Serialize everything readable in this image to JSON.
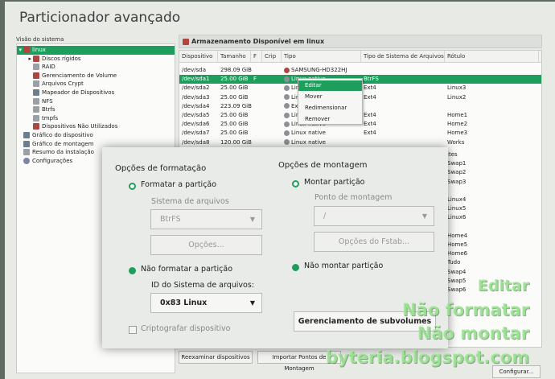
{
  "window": {
    "title": "Particionador avançado"
  },
  "sidebar": {
    "header": "Visão do sistema",
    "items": [
      {
        "label": "linux",
        "icon": "disk-icon",
        "indent": 0
      },
      {
        "label": "Discos rígidos",
        "icon": "disk-icon",
        "indent": 1
      },
      {
        "label": "RAID",
        "icon": "doc-icon",
        "indent": 1
      },
      {
        "label": "Gerenciamento de Volume",
        "icon": "disk-icon",
        "indent": 1
      },
      {
        "label": "Arquivos Crypt",
        "icon": "doc-icon",
        "indent": 1
      },
      {
        "label": "Mapeador de Dispositivos",
        "icon": "box-icon",
        "indent": 1
      },
      {
        "label": "NFS",
        "icon": "doc-icon",
        "indent": 1
      },
      {
        "label": "Btrfs",
        "icon": "doc-icon",
        "indent": 1
      },
      {
        "label": "tmpfs",
        "icon": "doc-icon",
        "indent": 1
      },
      {
        "label": "Dispositivos Não Utilizados",
        "icon": "disk-icon",
        "indent": 1
      },
      {
        "label": "Gráfico do dispositivo",
        "icon": "box-icon",
        "indent": 0
      },
      {
        "label": "Gráfico de montagem",
        "icon": "box-icon",
        "indent": 0
      },
      {
        "label": "Resumo da instalação",
        "icon": "doc-icon",
        "indent": 0
      },
      {
        "label": "Configurações",
        "icon": "gear-icon",
        "indent": 0
      }
    ]
  },
  "panel": {
    "title": "Armazenamento Disponível em linux",
    "columns": [
      "Dispositivo",
      "Tamanho",
      "F",
      "Crip",
      "Tipo",
      "Tipo de Sistema de Arquivos",
      "Rótulo"
    ],
    "rows": [
      [
        "/dev/sda",
        "298.09 GiB",
        "",
        "",
        "SAMSUNG-HD322HJ",
        "",
        ""
      ],
      [
        "/dev/sda1",
        "25.00 GiB",
        "F",
        "",
        "Linux native",
        "BtrFS",
        ""
      ],
      [
        "/dev/sda2",
        "25.00 GiB",
        "",
        "",
        "Linux native",
        "Ext4",
        "Linux3"
      ],
      [
        "/dev/sda3",
        "25.00 GiB",
        "",
        "",
        "Linux native",
        "Ext4",
        "Linux2"
      ],
      [
        "/dev/sda4",
        "223.09 GiB",
        "",
        "",
        "Extended",
        "",
        ""
      ],
      [
        "/dev/sda5",
        "25.00 GiB",
        "",
        "",
        "Linux native",
        "Ext4",
        "Home1"
      ],
      [
        "/dev/sda6",
        "25.00 GiB",
        "",
        "",
        "Linux native",
        "Ext4",
        "Home2"
      ],
      [
        "/dev/sda7",
        "25.00 GiB",
        "",
        "",
        "Linux native",
        "Ext4",
        "Home3"
      ],
      [
        "/dev/sda8",
        "120.00 GiB",
        "",
        "",
        "Linux native",
        "",
        "Works"
      ]
    ],
    "hidden_labels": [
      "ites",
      "Swap1",
      "Swap2",
      "Swap3",
      "",
      "Linux4",
      "Linux5",
      "Linux6",
      "",
      "Home4",
      "Home5",
      "Home6",
      "Tudo",
      "Swap4",
      "Swap5",
      "Swap6"
    ],
    "buttons": [
      "Reexaminar dispositivos",
      "Importar Pontos de Montagem",
      "Configurar..."
    ]
  },
  "context_menu": {
    "items": [
      "Editar",
      "Mover",
      "Redimensionar",
      "Remover"
    ]
  },
  "dialog": {
    "format_heading": "Opções de formatação",
    "format_option": "Formatar a partição",
    "filesystem_label": "Sistema de arquivos",
    "filesystem_value": "BtrFS",
    "options_button": "Opções...",
    "no_format_option": "Não formatar a partição",
    "fs_id_label": "ID do Sistema de arquivos:",
    "fs_id_value": "0x83 Linux",
    "encrypt_label": "Criptografar dispositivo",
    "mount_heading": "Opções de montagem",
    "mount_option": "Montar partição",
    "mount_point_label": "Ponto de montagem",
    "mount_point_value": "/",
    "fstab_button": "Opções do Fstab...",
    "no_mount_option": "Não montar partição",
    "subvolumes_button": "Gerenciamento de subvolumes"
  },
  "watermark": {
    "lines": [
      "Editar",
      "Não formatar",
      "Não montar",
      "byteria.blogspot.com"
    ]
  }
}
